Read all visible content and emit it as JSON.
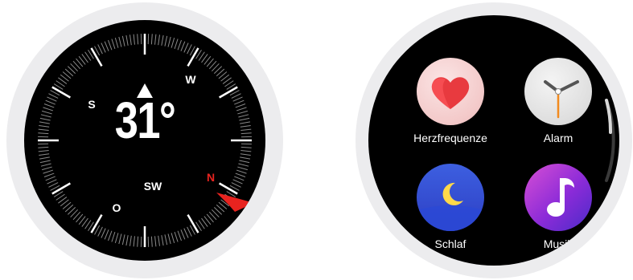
{
  "compass": {
    "heading": "31°",
    "labels": {
      "n": "N",
      "w": "W",
      "s": "S",
      "sw": "SW",
      "o": "O"
    },
    "colors": {
      "north": "#e8231f",
      "face": "#000000",
      "bezel": "#ececee"
    }
  },
  "apps": {
    "items": [
      {
        "label": "Herzfrequenze",
        "icon": "heart-icon"
      },
      {
        "label": "Alarm",
        "icon": "clock-icon"
      },
      {
        "label": "Schlaf",
        "icon": "moon-icon"
      },
      {
        "label": "Musik",
        "icon": "music-note-icon"
      }
    ]
  }
}
